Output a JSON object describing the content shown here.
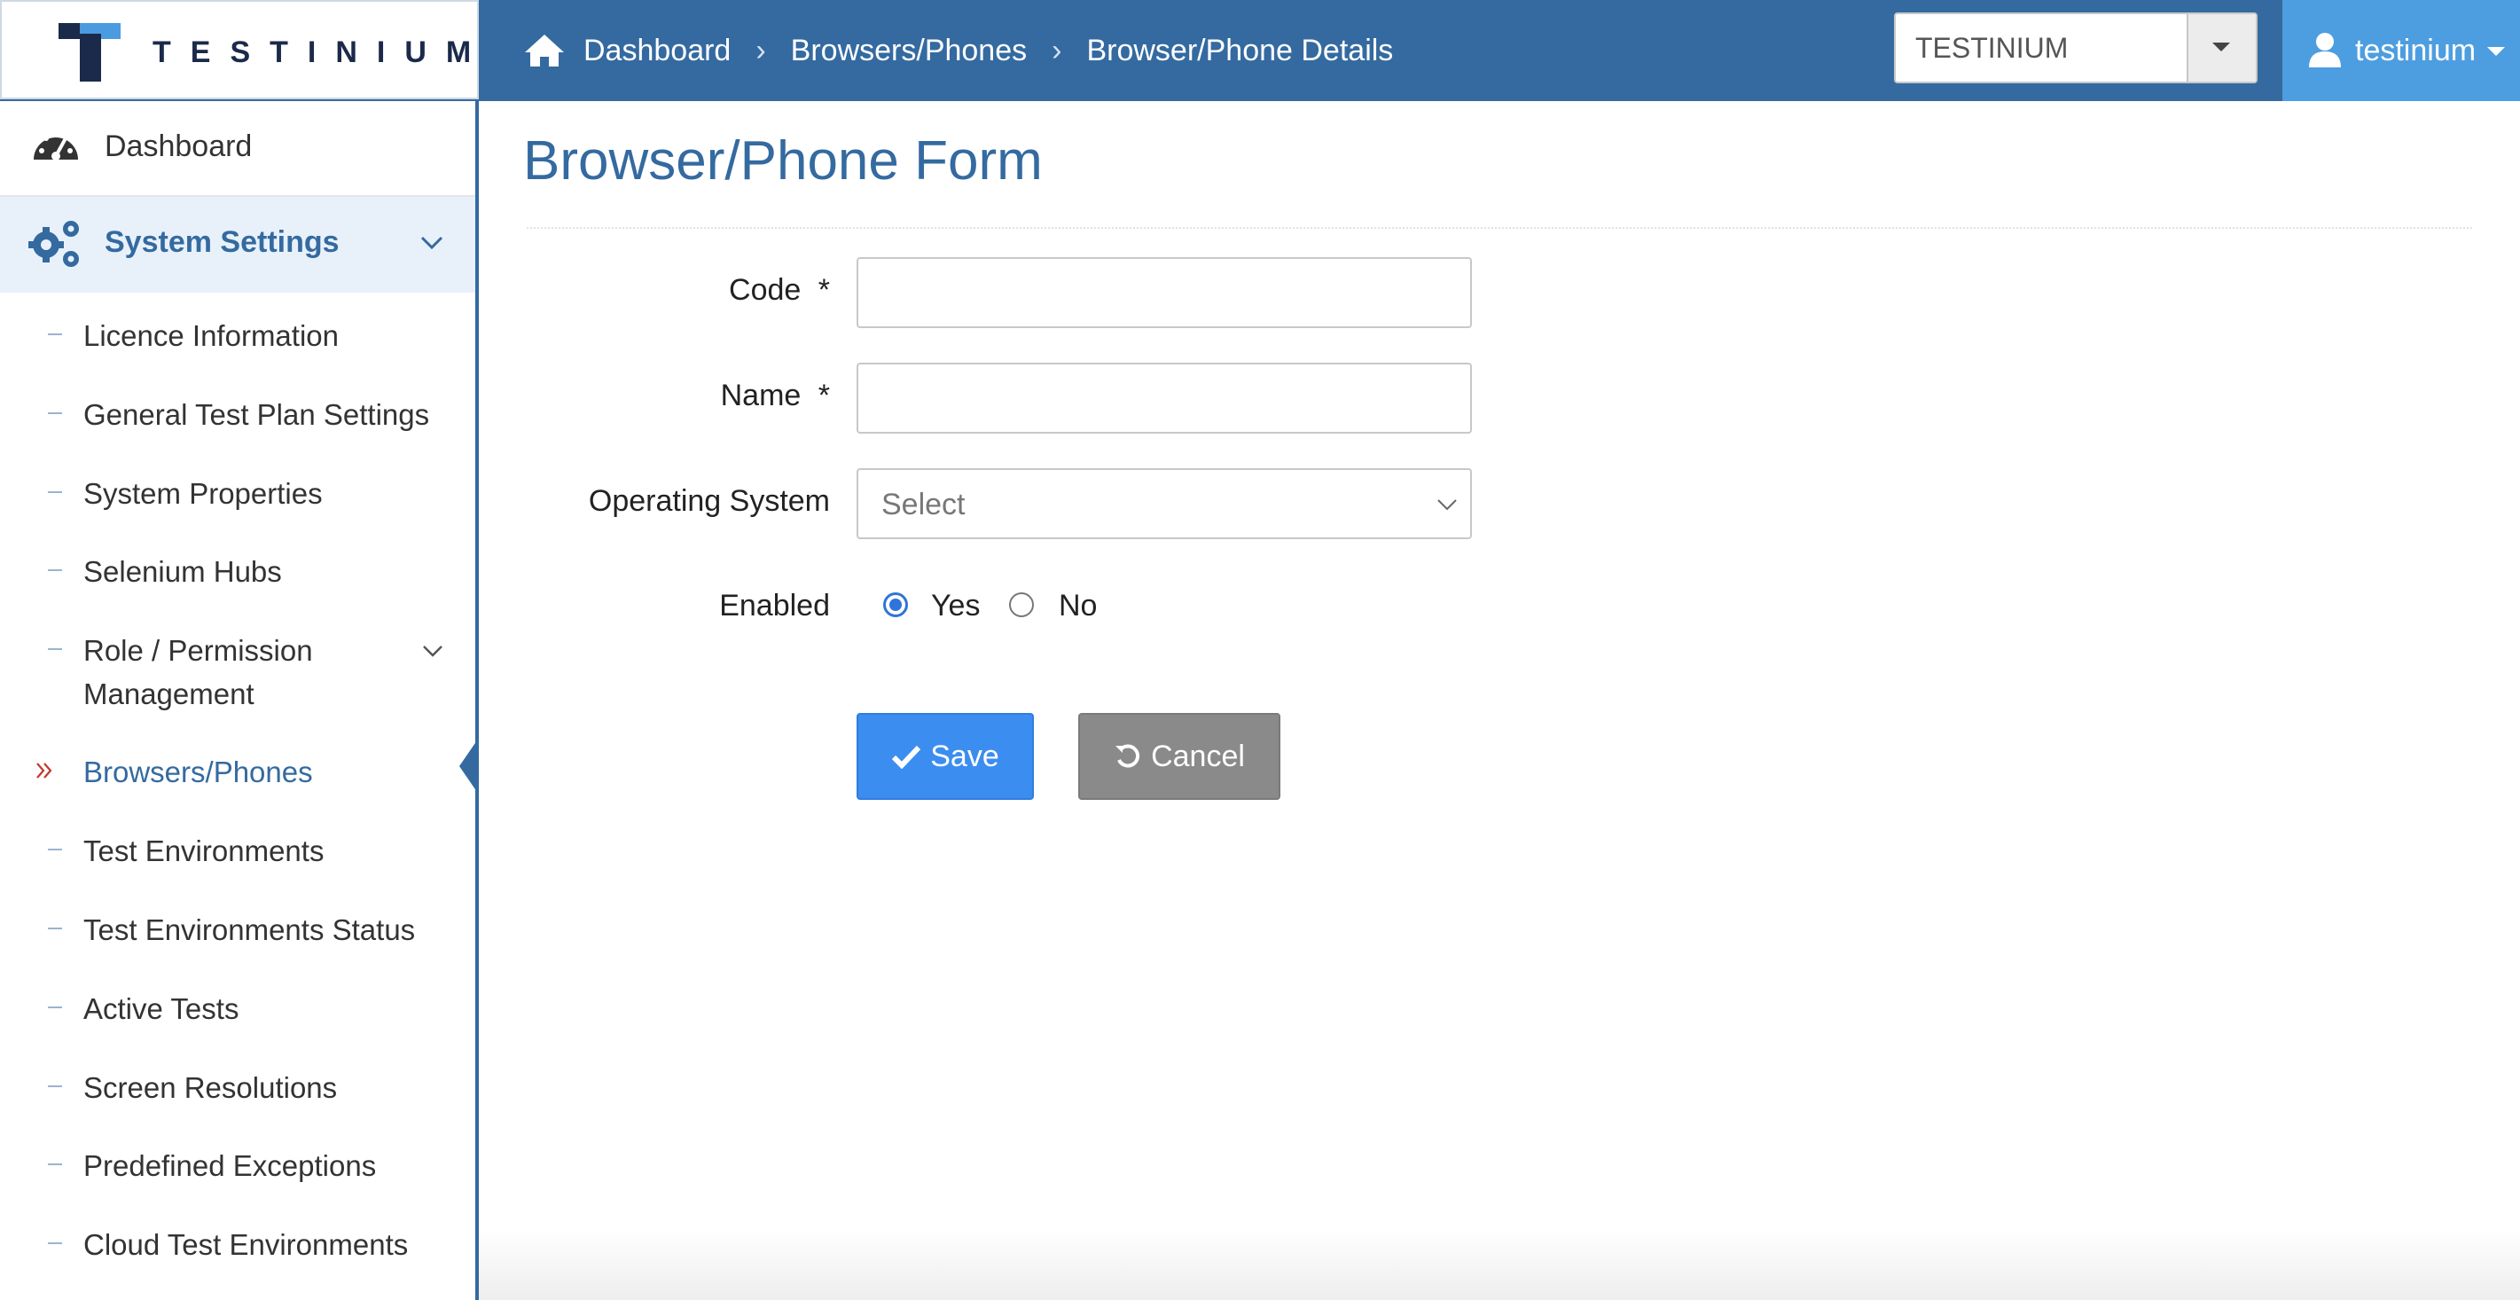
{
  "brand": {
    "name": "TESTINIUM"
  },
  "breadcrumb": {
    "items": [
      "Dashboard",
      "Browsers/Phones",
      "Browser/Phone Details"
    ]
  },
  "header": {
    "tenant_value": "TESTINIUM",
    "user_name": "testinium"
  },
  "sidebar": {
    "dashboard": "Dashboard",
    "section": "System Settings",
    "items": [
      "Licence Information",
      "General Test Plan Settings",
      "System Properties",
      "Selenium Hubs",
      "Role / Permission",
      "Browsers/Phones",
      "Test Environments",
      "Test Environments Status",
      "Active Tests",
      "Screen Resolutions",
      "Predefined Exceptions",
      "Cloud Test Environments"
    ],
    "role_line2": "Management",
    "active_item": "Browsers/Phones"
  },
  "form": {
    "title": "Browser/Phone Form",
    "code_label": "Code",
    "name_label": "Name",
    "required_mark": "*",
    "code_value": "",
    "name_value": "",
    "os_label": "Operating System",
    "os_value": "Select",
    "enabled_label": "Enabled",
    "enabled_yes": "Yes",
    "enabled_no": "No",
    "enabled_selected": "Yes",
    "save_label": "Save",
    "cancel_label": "Cancel"
  },
  "colors": {
    "primary": "#346aa0",
    "user_area": "#4d9ee0",
    "save": "#3c8df0",
    "cancel": "#8a8a8a",
    "active_arrow": "#c0392b"
  }
}
